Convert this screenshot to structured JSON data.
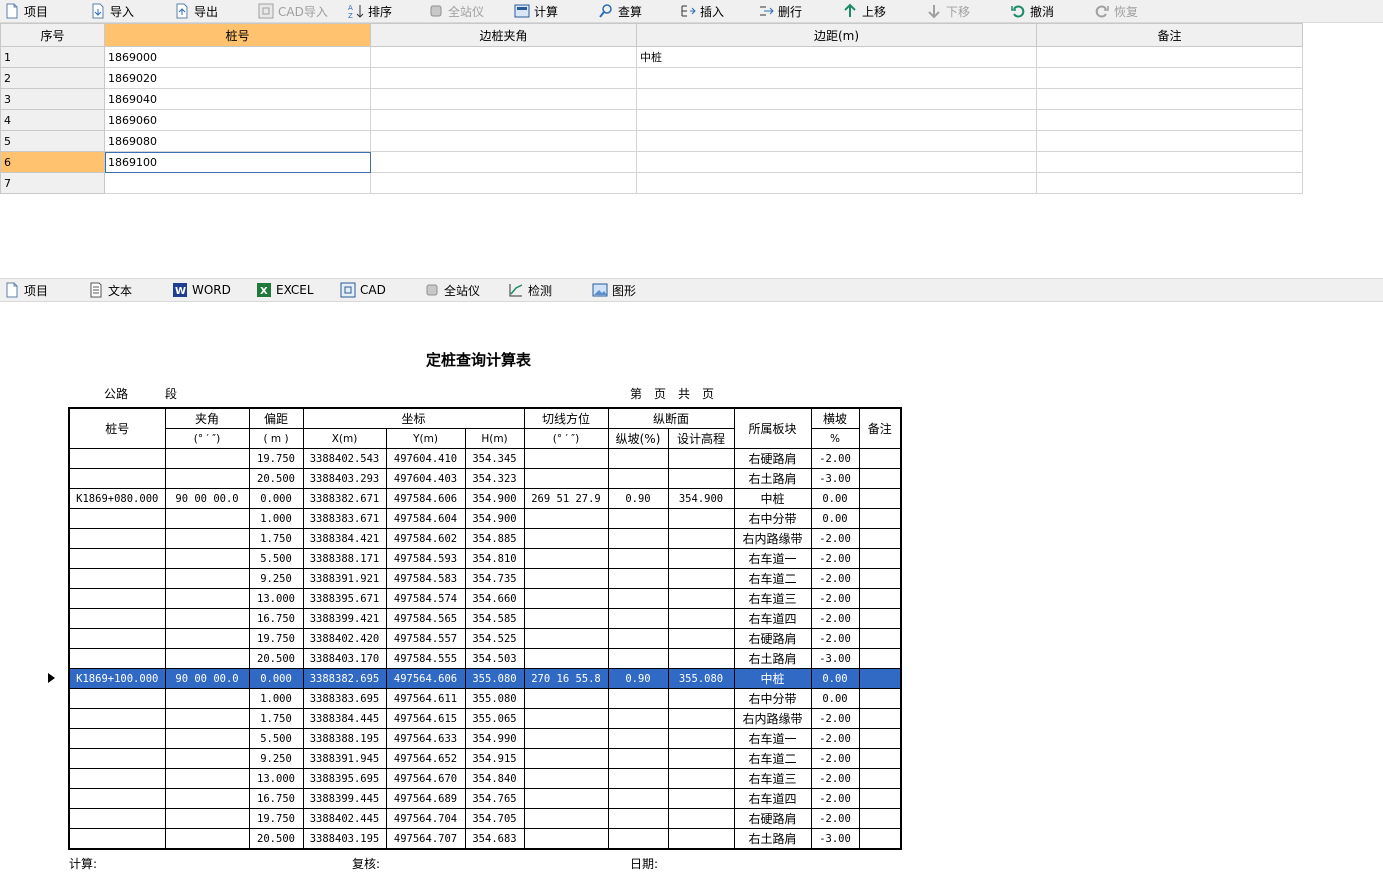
{
  "toolbar_top": [
    {
      "label": "项目",
      "icon": "new-document-icon",
      "enabled": true
    },
    {
      "label": "导入",
      "icon": "import-icon",
      "enabled": true
    },
    {
      "label": "导出",
      "icon": "export-icon",
      "enabled": true
    },
    {
      "label": "CAD导入",
      "icon": "cad-import-icon",
      "enabled": false
    },
    {
      "label": "排序",
      "icon": "sort-az-icon",
      "enabled": true
    },
    {
      "label": "全站仪",
      "icon": "total-station-icon",
      "enabled": false
    },
    {
      "label": "计算",
      "icon": "calculator-icon",
      "enabled": true
    },
    {
      "label": "查算",
      "icon": "search-icon",
      "enabled": true
    },
    {
      "label": "插入",
      "icon": "insert-row-icon",
      "enabled": true
    },
    {
      "label": "删行",
      "icon": "delete-row-icon",
      "enabled": true
    },
    {
      "label": "上移",
      "icon": "arrow-up-icon",
      "enabled": true
    },
    {
      "label": "下移",
      "icon": "arrow-down-icon",
      "enabled": false
    },
    {
      "label": "撤消",
      "icon": "undo-icon",
      "enabled": true
    },
    {
      "label": "恢复",
      "icon": "redo-icon",
      "enabled": false
    }
  ],
  "grid": {
    "headers": [
      "序号",
      "桩号",
      "边桩夹角",
      "边距(m)",
      "备注"
    ],
    "active_header": 1,
    "rows": [
      {
        "num": "1",
        "stake": "1869000",
        "angle": "",
        "offset": "中桩",
        "note": ""
      },
      {
        "num": "2",
        "stake": "1869020",
        "angle": "",
        "offset": "",
        "note": ""
      },
      {
        "num": "3",
        "stake": "1869040",
        "angle": "",
        "offset": "",
        "note": ""
      },
      {
        "num": "4",
        "stake": "1869060",
        "angle": "",
        "offset": "",
        "note": ""
      },
      {
        "num": "5",
        "stake": "1869080",
        "angle": "",
        "offset": "",
        "note": ""
      },
      {
        "num": "6",
        "stake": "1869100",
        "angle": "",
        "offset": "",
        "note": ""
      },
      {
        "num": "7",
        "stake": "",
        "angle": "",
        "offset": "",
        "note": ""
      }
    ],
    "active_row": 5
  },
  "toolbar_bottom": [
    {
      "label": "项目",
      "icon": "new-document-icon"
    },
    {
      "label": "文本",
      "icon": "text-file-icon"
    },
    {
      "label": "WORD",
      "icon": "word-icon"
    },
    {
      "label": "EXCEL",
      "icon": "excel-icon"
    },
    {
      "label": "CAD",
      "icon": "cad-icon"
    },
    {
      "label": "全站仪",
      "icon": "total-station-icon"
    },
    {
      "label": "检测",
      "icon": "check-chart-icon"
    },
    {
      "label": "图形",
      "icon": "image-icon"
    }
  ],
  "report": {
    "title": "定桩查询计算表",
    "road_label": "公路",
    "section_label": "段",
    "page_label": "第　页　共　页",
    "headers": {
      "stake": "桩号",
      "angle": "夹角",
      "angle_unit": "(° ′ ″)",
      "offset": "偏距",
      "offset_unit": "( m )",
      "coord": "坐标",
      "x": "X(m)",
      "y": "Y(m)",
      "h": "H(m)",
      "bearing": "切线方位",
      "bearing_unit": "(° ′ ″)",
      "profile": "纵断面",
      "grade": "纵坡(%)",
      "design_elev": "设计高程",
      "block": "所属板块",
      "cross_slope": "横坡",
      "cross_slope_unit": "%",
      "note": "备注"
    },
    "rows": [
      {
        "stake": "",
        "angle": "",
        "offset": "19.750",
        "x": "3388402.543",
        "y": "497604.410",
        "h": "354.345",
        "bearing": "",
        "grade": "",
        "elev": "",
        "block": "右硬路肩",
        "slope": "-2.00",
        "note": ""
      },
      {
        "stake": "",
        "angle": "",
        "offset": "20.500",
        "x": "3388403.293",
        "y": "497604.403",
        "h": "354.323",
        "bearing": "",
        "grade": "",
        "elev": "",
        "block": "右土路肩",
        "slope": "-3.00",
        "note": ""
      },
      {
        "stake": "K1869+080.000",
        "angle": "90 00 00.0",
        "offset": "0.000",
        "x": "3388382.671",
        "y": "497584.606",
        "h": "354.900",
        "bearing": "269 51 27.9",
        "grade": "0.90",
        "elev": "354.900",
        "block": "中桩",
        "slope": "0.00",
        "note": ""
      },
      {
        "stake": "",
        "angle": "",
        "offset": "1.000",
        "x": "3388383.671",
        "y": "497584.604",
        "h": "354.900",
        "bearing": "",
        "grade": "",
        "elev": "",
        "block": "右中分带",
        "slope": "0.00",
        "note": ""
      },
      {
        "stake": "",
        "angle": "",
        "offset": "1.750",
        "x": "3388384.421",
        "y": "497584.602",
        "h": "354.885",
        "bearing": "",
        "grade": "",
        "elev": "",
        "block": "右内路缘带",
        "slope": "-2.00",
        "note": ""
      },
      {
        "stake": "",
        "angle": "",
        "offset": "5.500",
        "x": "3388388.171",
        "y": "497584.593",
        "h": "354.810",
        "bearing": "",
        "grade": "",
        "elev": "",
        "block": "右车道一",
        "slope": "-2.00",
        "note": ""
      },
      {
        "stake": "",
        "angle": "",
        "offset": "9.250",
        "x": "3388391.921",
        "y": "497584.583",
        "h": "354.735",
        "bearing": "",
        "grade": "",
        "elev": "",
        "block": "右车道二",
        "slope": "-2.00",
        "note": ""
      },
      {
        "stake": "",
        "angle": "",
        "offset": "13.000",
        "x": "3388395.671",
        "y": "497584.574",
        "h": "354.660",
        "bearing": "",
        "grade": "",
        "elev": "",
        "block": "右车道三",
        "slope": "-2.00",
        "note": ""
      },
      {
        "stake": "",
        "angle": "",
        "offset": "16.750",
        "x": "3388399.421",
        "y": "497584.565",
        "h": "354.585",
        "bearing": "",
        "grade": "",
        "elev": "",
        "block": "右车道四",
        "slope": "-2.00",
        "note": ""
      },
      {
        "stake": "",
        "angle": "",
        "offset": "19.750",
        "x": "3388402.420",
        "y": "497584.557",
        "h": "354.525",
        "bearing": "",
        "grade": "",
        "elev": "",
        "block": "右硬路肩",
        "slope": "-2.00",
        "note": ""
      },
      {
        "stake": "",
        "angle": "",
        "offset": "20.500",
        "x": "3388403.170",
        "y": "497584.555",
        "h": "354.503",
        "bearing": "",
        "grade": "",
        "elev": "",
        "block": "右土路肩",
        "slope": "-3.00",
        "note": ""
      },
      {
        "stake": "K1869+100.000",
        "angle": "90 00 00.0",
        "offset": "0.000",
        "x": "3388382.695",
        "y": "497564.606",
        "h": "355.080",
        "bearing": "270 16 55.8",
        "grade": "0.90",
        "elev": "355.080",
        "block": "中桩",
        "slope": "0.00",
        "note": ""
      },
      {
        "stake": "",
        "angle": "",
        "offset": "1.000",
        "x": "3388383.695",
        "y": "497564.611",
        "h": "355.080",
        "bearing": "",
        "grade": "",
        "elev": "",
        "block": "右中分带",
        "slope": "0.00",
        "note": ""
      },
      {
        "stake": "",
        "angle": "",
        "offset": "1.750",
        "x": "3388384.445",
        "y": "497564.615",
        "h": "355.065",
        "bearing": "",
        "grade": "",
        "elev": "",
        "block": "右内路缘带",
        "slope": "-2.00",
        "note": ""
      },
      {
        "stake": "",
        "angle": "",
        "offset": "5.500",
        "x": "3388388.195",
        "y": "497564.633",
        "h": "354.990",
        "bearing": "",
        "grade": "",
        "elev": "",
        "block": "右车道一",
        "slope": "-2.00",
        "note": ""
      },
      {
        "stake": "",
        "angle": "",
        "offset": "9.250",
        "x": "3388391.945",
        "y": "497564.652",
        "h": "354.915",
        "bearing": "",
        "grade": "",
        "elev": "",
        "block": "右车道二",
        "slope": "-2.00",
        "note": ""
      },
      {
        "stake": "",
        "angle": "",
        "offset": "13.000",
        "x": "3388395.695",
        "y": "497564.670",
        "h": "354.840",
        "bearing": "",
        "grade": "",
        "elev": "",
        "block": "右车道三",
        "slope": "-2.00",
        "note": ""
      },
      {
        "stake": "",
        "angle": "",
        "offset": "16.750",
        "x": "3388399.445",
        "y": "497564.689",
        "h": "354.765",
        "bearing": "",
        "grade": "",
        "elev": "",
        "block": "右车道四",
        "slope": "-2.00",
        "note": ""
      },
      {
        "stake": "",
        "angle": "",
        "offset": "19.750",
        "x": "3388402.445",
        "y": "497564.704",
        "h": "354.705",
        "bearing": "",
        "grade": "",
        "elev": "",
        "block": "右硬路肩",
        "slope": "-2.00",
        "note": ""
      },
      {
        "stake": "",
        "angle": "",
        "offset": "20.500",
        "x": "3388403.195",
        "y": "497564.707",
        "h": "354.683",
        "bearing": "",
        "grade": "",
        "elev": "",
        "block": "右土路肩",
        "slope": "-3.00",
        "note": ""
      }
    ],
    "highlight_row": 11,
    "footer": {
      "calc": "计算:",
      "review": "复核:",
      "date": "日期:"
    }
  },
  "colors": {
    "accent_header": "#ffc26e",
    "selection": "#316ac5",
    "toolbar_bg": "#f0f0f0"
  }
}
